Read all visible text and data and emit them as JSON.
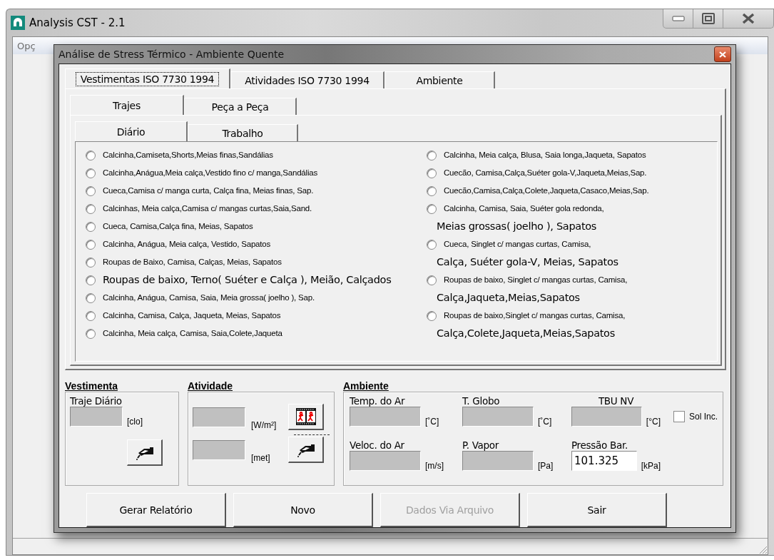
{
  "window": {
    "title": "Analysis CST - 2.1",
    "menu": [
      "Opç"
    ]
  },
  "dialog": {
    "title": "Análise de Stress Térmico - Ambiente Quente",
    "tabs": [
      {
        "label": "Vestimentas ISO 7730 1994",
        "selected": true
      },
      {
        "label": "Atividades ISO 7730 1994",
        "selected": false
      },
      {
        "label": "Ambiente",
        "selected": false
      }
    ],
    "subtabs": [
      {
        "label": "Trajes",
        "selected": true
      },
      {
        "label": "Peça a Peça",
        "selected": false
      }
    ],
    "subsubtabs": [
      {
        "label": "Diário",
        "selected": true
      },
      {
        "label": "Trabalho",
        "selected": false
      }
    ],
    "options_left": [
      {
        "label": "Calcinha,Camiseta,Shorts,Meias finas,Sandálias",
        "kind": "small",
        "selected": false
      },
      {
        "label": "Calcinha,Anágua,Meia calça,Vestido fino c/ manga,Sandálias",
        "kind": "small",
        "selected": false
      },
      {
        "label": "Cueca,Camisa c/ manga curta, Calça fina, Meias finas, Sap.",
        "kind": "small",
        "selected": false
      },
      {
        "label": "Calcinhas, Meia calça,Camisa c/ mangas curtas,Saia,Sand.",
        "kind": "small",
        "selected": false
      },
      {
        "label": "Cueca, Camisa,Calça fina, Meias, Sapatos",
        "kind": "small",
        "selected": false
      },
      {
        "label": "Calcinha, Anágua, Meia calça, Vestido, Sapatos",
        "kind": "small",
        "selected": false
      },
      {
        "label": "Roupas de Baixo, Camisa, Calças, Meias, Sapatos",
        "kind": "small",
        "selected": false
      },
      {
        "label": "Roupas de baixo, Terno( Suéter e Calça ), Meião, Calçados",
        "kind": "large",
        "selected": false
      },
      {
        "label": "Calcinha, Anágua, Camisa, Saia, Meia grossa( joelho ), Sap.",
        "kind": "small",
        "selected": false
      },
      {
        "label": "Calcinha, Camisa, Calça, Jaqueta, Meias, Sapatos",
        "kind": "small",
        "selected": false
      },
      {
        "label": "Calcinha, Meia calça, Camisa, Saia,Colete,Jaqueta",
        "kind": "small",
        "selected": false
      }
    ],
    "options_right": [
      {
        "label": "Calcinha, Meia calça, Blusa, Saia longa,Jaqueta, Sapatos",
        "kind": "small",
        "selected": false
      },
      {
        "label": "Cuecão, Camisa,Calça,Suéter gola-V,Jaqueta,Meias,Sap.",
        "kind": "small",
        "selected": false
      },
      {
        "label": "Cuecão,Camisa,Calça,Colete,Jaqueta,Casaco,Meias,Sap.",
        "kind": "small",
        "selected": false
      },
      {
        "label": "Calcinha, Camisa, Saia, Suéter gola redonda,",
        "second_line": "Meias grossas( joelho ), Sapatos",
        "kind": "small",
        "selected": false
      },
      {
        "label": "Cueca, Singlet c/ mangas curtas, Camisa,",
        "second_line": "Calça, Suéter gola-V, Meias, Sapatos",
        "kind": "small",
        "selected": false
      },
      {
        "label": "Roupas de baixo, Singlet c/ mangas curtas, Camisa,",
        "second_line": "Calça,Jaqueta,Meias,Sapatos",
        "kind": "small",
        "selected": false
      },
      {
        "label": "Roupas de baixo,Singlet c/ mangas curtas, Camisa,",
        "second_line": "Calça,Colete,Jaqueta,Meias,Sapatos",
        "kind": "small",
        "selected": false
      }
    ],
    "vestimenta": {
      "title": "Vestimenta",
      "label": "Traje Diário",
      "unit": "[clo]",
      "disabled": true
    },
    "atividade": {
      "title": "Atividade",
      "fields": [
        {
          "unit": "[W/m²]",
          "disabled": true
        },
        {
          "unit": "[met]",
          "disabled": true
        }
      ]
    },
    "ambiente": {
      "title": "Ambiente",
      "fields": [
        {
          "label": "Temp. do  Ar",
          "unit": "[˚C]",
          "disabled": true
        },
        {
          "label": "T. Globo",
          "unit": "[˚C]",
          "disabled": true
        },
        {
          "label": "TBU NV",
          "unit": "[°C]",
          "disabled": true
        },
        {
          "label": "Veloc. do Ar",
          "unit": "[m/s]",
          "disabled": true
        },
        {
          "label": "P. Vapor",
          "unit": "[Pa]",
          "disabled": true
        },
        {
          "label": "Pressão Bar.",
          "value": "101.325",
          "unit": "[kPa]",
          "disabled": false
        }
      ],
      "sol_inc": {
        "label": "Sol Inc.",
        "checked": false
      }
    },
    "buttons": [
      {
        "label": "Gerar Relatório",
        "disabled": false
      },
      {
        "label": "Novo",
        "disabled": false
      },
      {
        "label": "Dados Via Arquivo",
        "disabled": true
      },
      {
        "label": "Sair",
        "disabled": false
      }
    ]
  }
}
